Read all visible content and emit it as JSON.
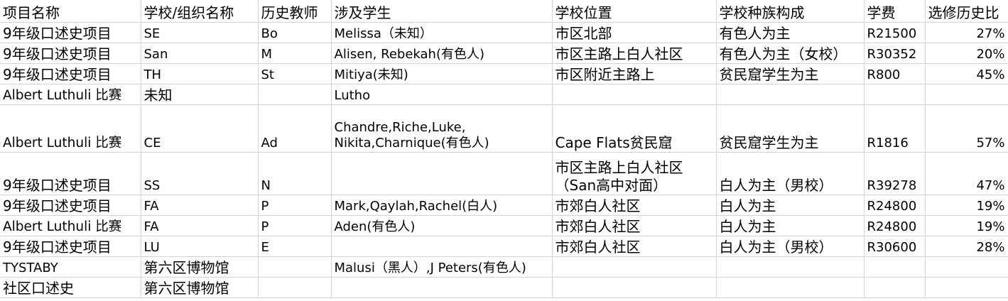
{
  "headers": [
    "项目名称",
    "学校/组织名称",
    "历史教师",
    "涉及学生",
    "学校位置",
    "学校种族构成",
    "学费",
    "选修历史比"
  ],
  "rows": [
    {
      "project": "9年级口述史项目",
      "school": "SE",
      "teacher": "Bo",
      "students": "Melissa（未知）",
      "location": "市区北部",
      "race": "有色人为主",
      "fee": "R21500",
      "ratio": "27%"
    },
    {
      "project": "9年级口述史项目",
      "school": "San",
      "teacher": "M",
      "students": "Alisen, Rebekah(有色人)",
      "location": "市区主路上白人社区",
      "race": "有色人为主（女校）",
      "fee": "R30352",
      "ratio": "20%"
    },
    {
      "project": "9年级口述史项目",
      "school": "TH",
      "teacher": "St",
      "students": "Mitiya(未知)",
      "location": "市区附近主路上",
      "race": "贫民窟学生为主",
      "fee": "R800",
      "ratio": "45%"
    },
    {
      "project": "Albert Luthuli 比赛",
      "school": "未知",
      "teacher": "",
      "students": "Lutho",
      "location": "",
      "race": "",
      "fee": "",
      "ratio": ""
    },
    {
      "project": "Albert Luthuli 比赛",
      "school": "CE",
      "teacher": "Ad",
      "students_lines": [
        "Chandre,Riche,Luke,",
        "Nikita,Charnique(有色人)"
      ],
      "location": "Cape Flats贫民窟",
      "race": "贫民窟学生为主",
      "fee": "R1816",
      "ratio": "57%"
    },
    {
      "project": "9年级口述史项目",
      "school": "SS",
      "teacher": "N",
      "students": "",
      "location_lines": [
        "市区主路上白人社区",
        "（San高中对面）"
      ],
      "race": "白人为主（男校）",
      "fee": "R39278",
      "ratio": "47%"
    },
    {
      "project": "9年级口述史项目",
      "school": "FA",
      "teacher": "P",
      "students": "Mark,Qaylah,Rachel(白人)",
      "location": "市郊白人社区",
      "race": "白人为主",
      "fee": "R24800",
      "ratio": "19%"
    },
    {
      "project": "Albert Luthuli 比赛",
      "school": "FA",
      "teacher": "P",
      "students": "Aden(有色人)",
      "location": "市郊白人社区",
      "race": "白人为主",
      "fee": "R24800",
      "ratio": "19%"
    },
    {
      "project": "9年级口述史项目",
      "school": "LU",
      "teacher": "E",
      "students": "",
      "location": "市郊白人社区",
      "race": "白人为主（男校）",
      "fee": "R30600",
      "ratio": "28%"
    },
    {
      "project": "TYSTABY",
      "school": "第六区博物馆",
      "teacher": "",
      "students": "Malusi（黑人）,J Peters(有色人)",
      "location": "",
      "race": "",
      "fee": "",
      "ratio": ""
    },
    {
      "project": "社区口述史",
      "school": "第六区博物馆",
      "teacher": "",
      "students": "",
      "location": "",
      "race": "",
      "fee": "",
      "ratio": ""
    }
  ]
}
